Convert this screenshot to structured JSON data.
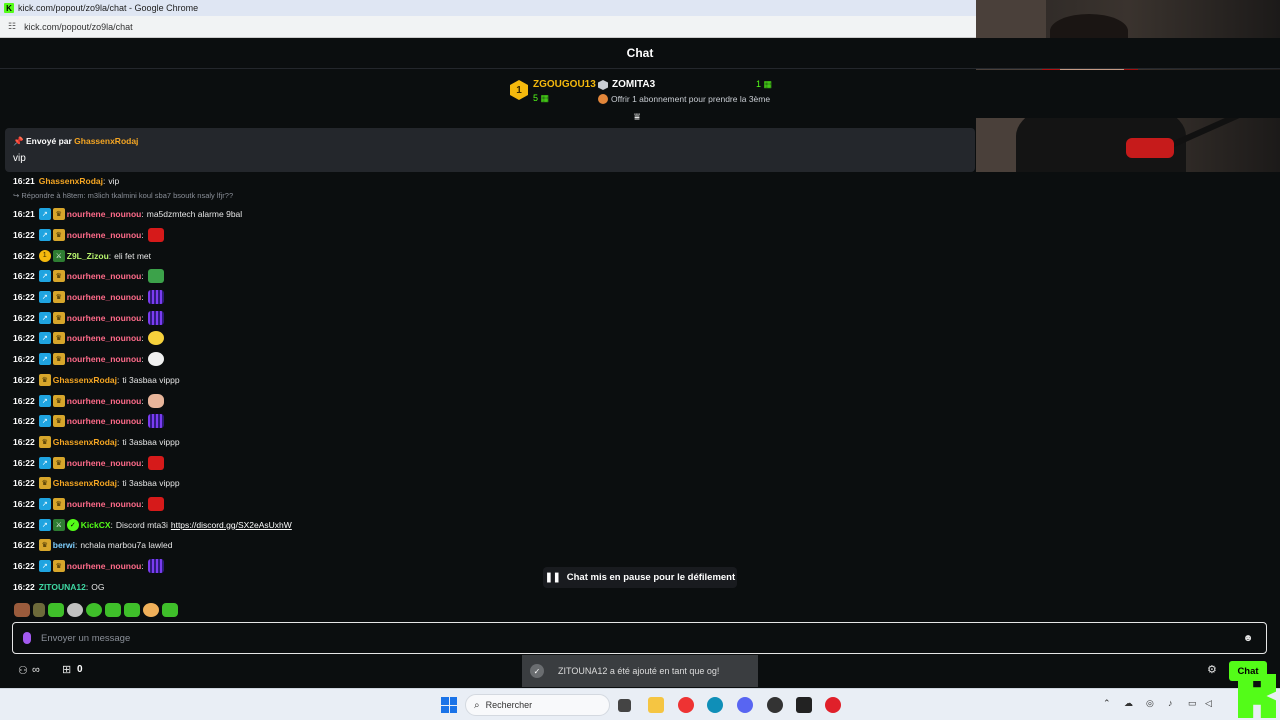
{
  "window": {
    "title": "kick.com/popout/zo9la/chat - Google Chrome",
    "url": "kick.com/popout/zo9la/chat"
  },
  "chat": {
    "header": "Chat"
  },
  "leaderboard": {
    "rank1_badge": "1",
    "first_name": "ZGOUGOU13",
    "first_count": "5",
    "second_name": "ZOMITA3",
    "second_count": "1",
    "offer": "Offrir 1 abonnement pour prendre la 3ème"
  },
  "pinned": {
    "sent_by_label": "Envoyé par",
    "sender": "GhassenxRodaj",
    "message": "vip"
  },
  "partial_message": {
    "time": "16:21",
    "user": "GhassenxRodaj",
    "text": "vip"
  },
  "reply_line": "Répondre à h8tem: m3lich tkalmini koul sba7 bsoutk nsaly lfjr??",
  "messages": [
    {
      "time": "16:21",
      "badges": [
        "boost",
        "sub"
      ],
      "user": "nourhene_nounou",
      "color": "#ff6b8a",
      "text": "ma5dzmtech alarme 9bal",
      "emote": ""
    },
    {
      "time": "16:22",
      "badges": [
        "boost",
        "sub"
      ],
      "user": "nourhene_nounou",
      "color": "#ff6b8a",
      "text": "",
      "emote": "e-red"
    },
    {
      "time": "16:22",
      "badges": [
        "og",
        "mod"
      ],
      "user": "Z9L_Zizou",
      "color": "#b8f56e",
      "text": "eli fet met",
      "emote": ""
    },
    {
      "time": "16:22",
      "badges": [
        "boost",
        "sub"
      ],
      "user": "nourhene_nounou",
      "color": "#ff6b8a",
      "text": "",
      "emote": "e-frog"
    },
    {
      "time": "16:22",
      "badges": [
        "boost",
        "sub"
      ],
      "user": "nourhene_nounou",
      "color": "#ff6b8a",
      "text": "",
      "emote": "e-purple"
    },
    {
      "time": "16:22",
      "badges": [
        "boost",
        "sub"
      ],
      "user": "nourhene_nounou",
      "color": "#ff6b8a",
      "text": "",
      "emote": "e-purple"
    },
    {
      "time": "16:22",
      "badges": [
        "boost",
        "sub"
      ],
      "user": "nourhene_nounou",
      "color": "#ff6b8a",
      "text": "",
      "emote": "e-chick"
    },
    {
      "time": "16:22",
      "badges": [
        "boost",
        "sub"
      ],
      "user": "nourhene_nounou",
      "color": "#ff6b8a",
      "text": "",
      "emote": "e-goose"
    },
    {
      "time": "16:22",
      "badges": [
        "sub"
      ],
      "user": "GhassenxRodaj",
      "color": "#f5a623",
      "text": "ti 3asbaa vippp",
      "emote": ""
    },
    {
      "time": "16:22",
      "badges": [
        "boost",
        "sub"
      ],
      "user": "nourhene_nounou",
      "color": "#ff6b8a",
      "text": "",
      "emote": "e-anime"
    },
    {
      "time": "16:22",
      "badges": [
        "boost",
        "sub"
      ],
      "user": "nourhene_nounou",
      "color": "#ff6b8a",
      "text": "",
      "emote": "e-purple"
    },
    {
      "time": "16:22",
      "badges": [
        "sub"
      ],
      "user": "GhassenxRodaj",
      "color": "#f5a623",
      "text": "ti 3asbaa vippp",
      "emote": ""
    },
    {
      "time": "16:22",
      "badges": [
        "boost",
        "sub"
      ],
      "user": "nourhene_nounou",
      "color": "#ff6b8a",
      "text": "",
      "emote": "e-red"
    },
    {
      "time": "16:22",
      "badges": [
        "sub"
      ],
      "user": "GhassenxRodaj",
      "color": "#f5a623",
      "text": "ti 3asbaa vippp",
      "emote": ""
    },
    {
      "time": "16:22",
      "badges": [
        "boost",
        "sub"
      ],
      "user": "nourhene_nounou",
      "color": "#ff6b8a",
      "text": "",
      "emote": "e-red"
    },
    {
      "time": "16:22",
      "badges": [
        "boost",
        "mod",
        "verif"
      ],
      "user": "KickCX",
      "color": "#53fc18",
      "text": "Discord mta3i",
      "link": "https://discord.gg/SX2eAsUxhW",
      "emote": ""
    },
    {
      "time": "16:22",
      "badges": [
        "sub"
      ],
      "user": "berwi",
      "color": "#7fd0ff",
      "text": "nchala marbou7a lawled",
      "emote": ""
    },
    {
      "time": "16:22",
      "badges": [
        "boost",
        "sub"
      ],
      "user": "nourhene_nounou",
      "color": "#ff6b8a",
      "text": "",
      "emote": "e-purple"
    },
    {
      "time": "16:22",
      "badges": [],
      "user": "ZITOUNA12",
      "color": "#3fd9a4",
      "text": "OG",
      "emote": ""
    }
  ],
  "paused": {
    "label": "Chat mis en pause pour le défilement"
  },
  "input": {
    "placeholder": "Envoyer un message"
  },
  "bottom": {
    "count": "0",
    "chat_button": "Chat"
  },
  "toast": {
    "text": "ZITOUNA12 a été ajouté en tant que og!"
  },
  "taskbar": {
    "search_label": "Rechercher"
  },
  "colors": {
    "kick_green": "#53fc18",
    "background": "#0b0e0f"
  }
}
